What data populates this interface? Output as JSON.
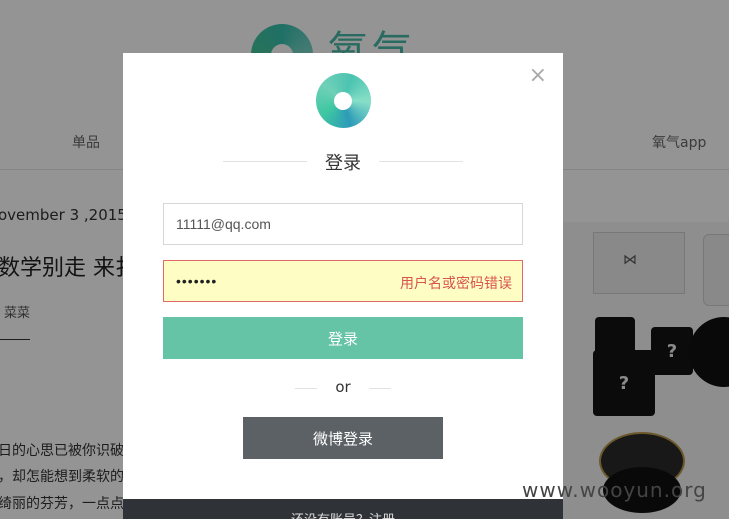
{
  "background": {
    "brand_name": "氧气",
    "nav": {
      "left": "单品",
      "right": "氧气app"
    },
    "article": {
      "date": "ovember 3 ,2015",
      "title": "数学别走 来扌",
      "tag": "菜菜",
      "lines": [
        "日的心思已被你识破",
        "，却怎能想到柔软的",
        "绮丽的芬芳，一点点"
      ]
    },
    "photo_marks": [
      "?",
      "?",
      "?"
    ]
  },
  "watermark": "www.wooyun.org",
  "modal": {
    "close_symbol": "×",
    "title": "登录",
    "email_value": "11111@qq.com",
    "password_value": "•••••••",
    "error_message": "用户名或密码错误",
    "login_button": "登录",
    "or_text": "or",
    "weibo_button": "微博登录",
    "footer_text": "还没有账号？注册"
  },
  "colors": {
    "accent": "#65c3a6",
    "error": "#d9534f",
    "error_bg": "#fdfdc4",
    "weibo_button": "#5c6165",
    "footer": "#2f3338"
  }
}
